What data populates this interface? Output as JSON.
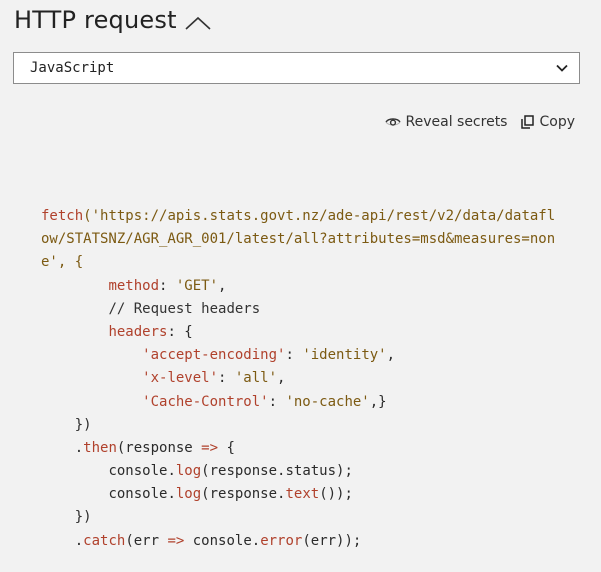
{
  "header": {
    "title": "HTTP request",
    "collapse_icon": "chevron-up-icon"
  },
  "language_select": {
    "selected": "JavaScript",
    "icon": "chevron-down-icon"
  },
  "actions": {
    "reveal_label": "Reveal secrets",
    "reveal_icon": "eye-icon",
    "copy_label": "Copy",
    "copy_icon": "copy-icon"
  },
  "code": {
    "line1a": "fetch",
    "line1b": "('https://apis.stats.govt.nz/ade-api/rest/v2/data/datafl",
    "line2": "ow/STATSNZ/AGR_AGR_001/latest/all?attributes=msd&measures=non",
    "line3": "e', {",
    "method_key": "method",
    "method_sep": ": ",
    "method_val": "'GET'",
    "method_end": ",",
    "comment": "// Request headers",
    "headers_key": "headers",
    "headers_sep": ": {",
    "h1_key": "'accept-encoding'",
    "h1_sep": ": ",
    "h1_val": "'identity'",
    "h1_end": ",",
    "h2_key": "'x-level'",
    "h2_sep": ": ",
    "h2_val": "'all'",
    "h2_end": ",",
    "h3_key": "'Cache-Control'",
    "h3_sep": ": ",
    "h3_val": "'no-cache'",
    "h3_end": ",}",
    "close1": "})",
    "then_dot": ".",
    "then_kw": "then",
    "then_rest1": "(response ",
    "arrow1": "=>",
    "then_rest2": " {",
    "log1a": "console.",
    "log1b": "log",
    "log1c": "(response.status);",
    "log2a": "console.",
    "log2b": "log",
    "log2c": "(response.",
    "log2d": "text",
    "log2e": "());",
    "close2": "})",
    "catch_dot": ".",
    "catch_kw": "catch",
    "catch_rest1": "(err ",
    "arrow2": "=>",
    "catch_rest2": " console.",
    "catch_err": "error",
    "catch_rest3": "(err));"
  }
}
